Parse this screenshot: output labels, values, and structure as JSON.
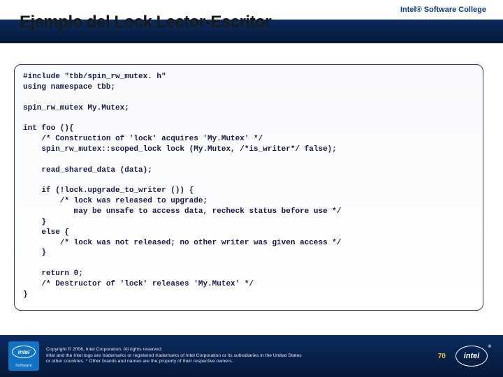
{
  "header": {
    "college_label": "Intel® Software College",
    "title": "Ejemplo del Lock  Lector-Escritor"
  },
  "code": "#include \"tbb/spin_rw_mutex. h\"\nusing namespace tbb;\n\nspin_rw_mutex My.Mutex;\n\nint foo (){\n    /* Construction of 'lock' acquires 'My.Mutex' */\n    spin_rw_mutex::scoped_lock lock (My.Mutex, /*is_writer*/ false);\n\n    read_shared_data (data);\n\n    if (!lock.upgrade_to_writer ()) {\n        /* lock was released to upgrade;\n           may be unsafe to access data, recheck status before use */\n    }\n    else {\n        /* lock was not released; no other writer was given access */\n    }\n\n    return 0;\n    /* Destructor of 'lock' releases 'My.Mutex' */\n}",
  "footer": {
    "badge_text": "intel",
    "badge_sub": "Software",
    "copyright": "Copyright © 2006, Intel Corporation. All rights reserved.\nIntel and the Intel logo are trademarks or registered trademarks of Intel Corporation or its subsidiaries in the United States\nor other countries. * Other brands and names are the property of their respective owners.",
    "page_number": "70",
    "logo_text": "intel"
  }
}
